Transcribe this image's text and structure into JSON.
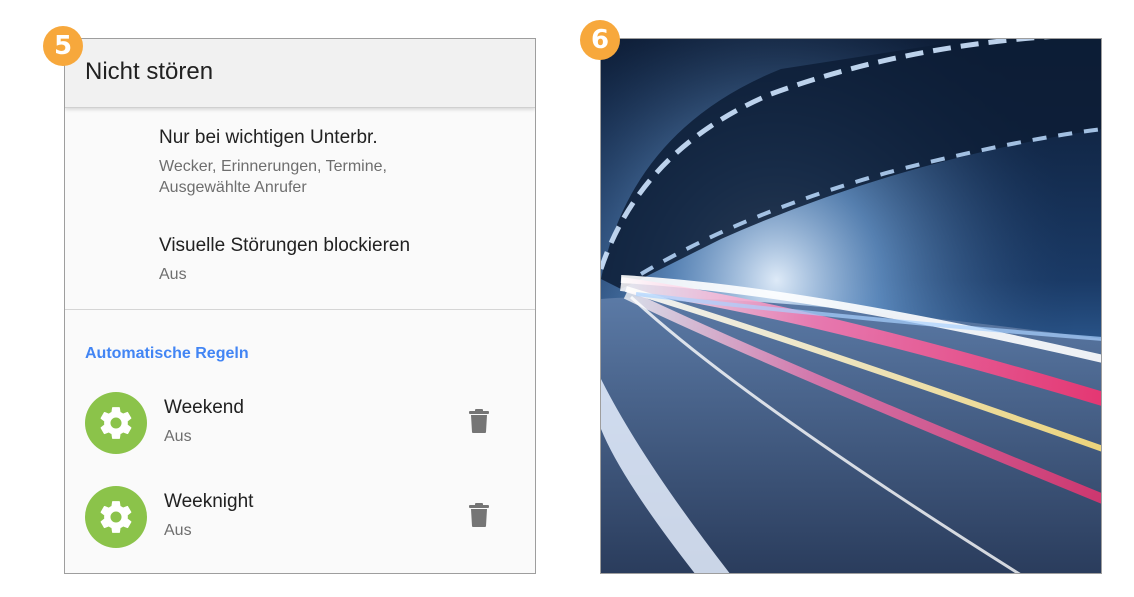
{
  "badges": {
    "left": "5",
    "right": "6"
  },
  "screen": {
    "title": "Nicht stören",
    "settings": [
      {
        "primary": "Nur bei wichtigen Unterbr.",
        "secondary": "Wecker, Erinnerungen, Termine, Ausgewählte Anrufer"
      },
      {
        "primary": "Visuelle Störungen blockieren",
        "secondary": "Aus"
      }
    ],
    "section_header": "Automatische Regeln",
    "rules": [
      {
        "name": "Weekend",
        "state": "Aus",
        "icon": "gear-icon",
        "delete_icon": "trash-icon"
      },
      {
        "name": "Weeknight",
        "state": "Aus",
        "icon": "gear-icon",
        "delete_icon": "trash-icon"
      }
    ]
  },
  "colors": {
    "badge": "#f7a83c",
    "accent": "#4285f4",
    "rule_icon_bg": "#8bc34a"
  }
}
